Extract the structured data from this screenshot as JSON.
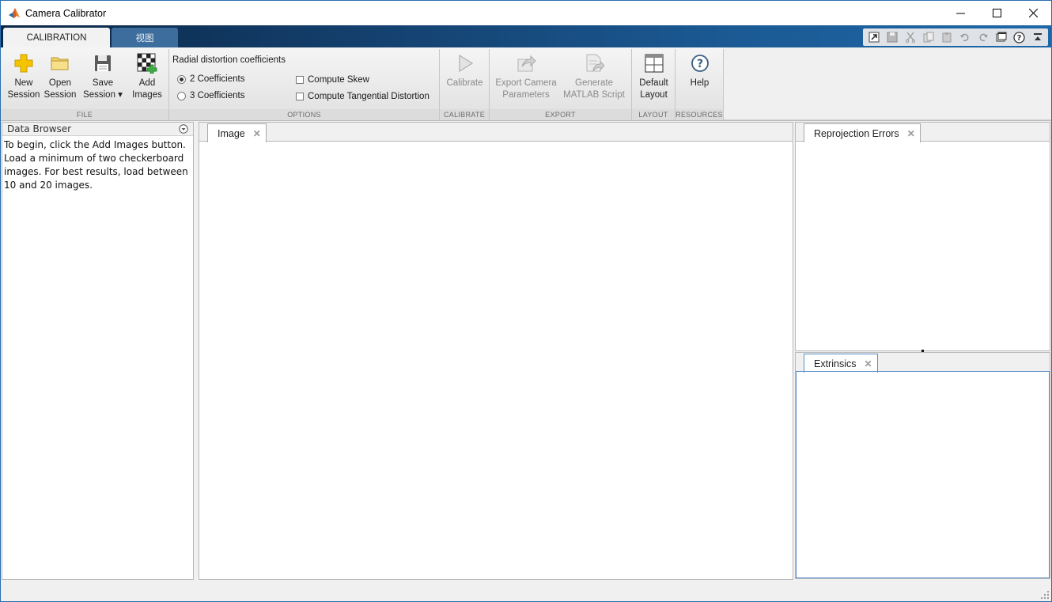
{
  "window": {
    "title": "Camera Calibrator"
  },
  "ribbon_tabs": [
    {
      "label": "CALIBRATION",
      "active": true
    },
    {
      "label": "视图",
      "active": false
    }
  ],
  "quick_access": [
    "dock-icon",
    "save-icon",
    "cut-icon",
    "copy-icon",
    "paste-icon",
    "undo-icon",
    "redo-icon",
    "window-icon",
    "help-icon",
    "collapse-icon"
  ],
  "ribbon": {
    "file": {
      "label": "FILE",
      "new_session": "New\nSession",
      "open_session": "Open\nSession",
      "save_session": "Save\nSession ▾",
      "add_images": "Add\nImages"
    },
    "options": {
      "label": "OPTIONS",
      "radial_title": "Radial distortion coefficients",
      "radio_2": "2 Coefficients",
      "radio_3": "3 Coefficients",
      "skew": "Compute Skew",
      "tangential": "Compute Tangential Distortion"
    },
    "calibrate": {
      "label": "CALIBRATE",
      "button": "Calibrate"
    },
    "export": {
      "label": "EXPORT",
      "export_params": "Export Camera\nParameters",
      "generate_script": "Generate\nMATLAB Script"
    },
    "layout": {
      "label": "LAYOUT",
      "default_layout": "Default\nLayout"
    },
    "resources": {
      "label": "RESOURCES",
      "help": "Help"
    }
  },
  "data_browser": {
    "title": "Data Browser",
    "message": "To begin, click the Add Images button. Load a minimum of two checkerboard images. For best results, load between 10 and 20 images."
  },
  "documents": {
    "image": "Image",
    "reprojection": "Reprojection Errors",
    "extrinsics": "Extrinsics"
  },
  "colors": {
    "tabstrip_dark": "#0a2746",
    "tabstrip_light": "#1d67a8",
    "accent_blue": "#2a6fb0",
    "add_icon_yellow": "#f5c400"
  }
}
